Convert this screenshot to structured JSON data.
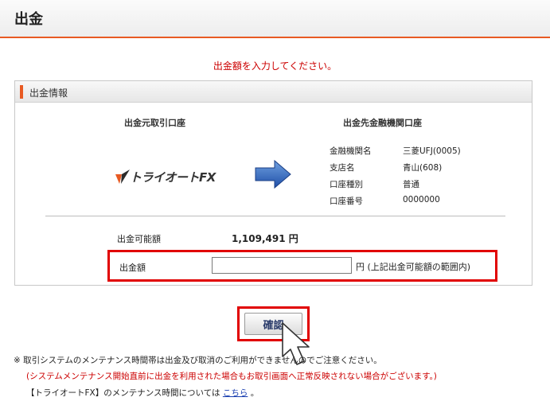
{
  "header": {
    "title": "出金"
  },
  "instruction": "出金額を入力してください。",
  "panel": {
    "title": "出金情報",
    "source_heading": "出金元取引口座",
    "dest_heading": "出金先金融機関口座",
    "logo_text": "トライオートFX",
    "bank_info": [
      {
        "label": "金融機関名",
        "value": "三菱UFJ(0005)"
      },
      {
        "label": "支店名",
        "value": "青山(608)"
      },
      {
        "label": "口座種別",
        "value": "普通"
      },
      {
        "label": "口座番号",
        "value": "0000000"
      }
    ],
    "available_label": "出金可能額",
    "available_value": "1,109,491 円",
    "amount_label": "出金額",
    "amount_value": "",
    "amount_unit": "円 (上記出金可能額の範囲内)"
  },
  "confirm_label": "確認",
  "notes": {
    "line1_prefix": "※ 取引システムのメンテナンス時間帯は出金及び取消のご利用ができませんのでご注意ください。",
    "line2": "(システムメンテナンス開始直前に出金を利用された場合もお取引画面へ正常反映されない場合がございます。)",
    "line3_before": "【トライオートFX】のメンテナンス時間については",
    "line3_link": "こちら",
    "line3_after": "。"
  },
  "colors": {
    "accent": "#e85a22",
    "alert": "#cc0000",
    "highlight_border": "#e10000",
    "link": "#1a3fb0"
  }
}
